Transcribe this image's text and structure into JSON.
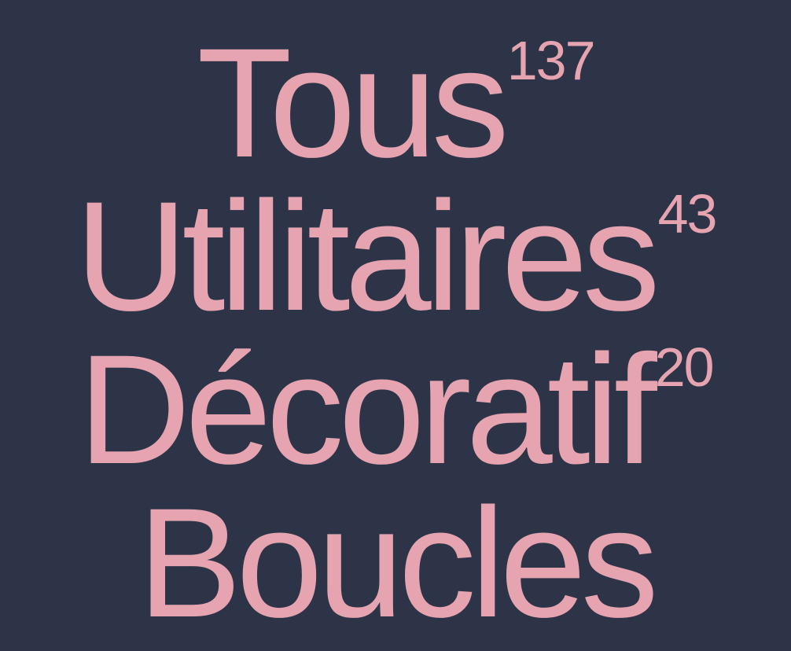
{
  "theme": {
    "background": "#2e3448",
    "text": "#e6a4b0"
  },
  "filters": [
    {
      "label": "Tous",
      "count": "137"
    },
    {
      "label": "Utilitaires",
      "count": "43"
    },
    {
      "label": "Décoratif",
      "count": "20"
    },
    {
      "label": "Boucles",
      "count": ""
    }
  ]
}
